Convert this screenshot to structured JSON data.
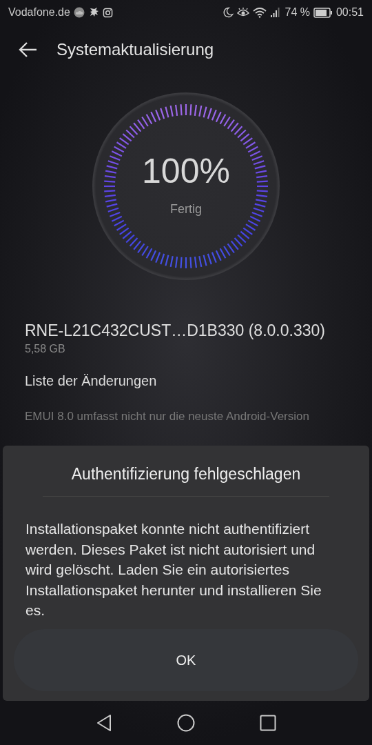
{
  "status_bar": {
    "carrier": "Vodafone.de",
    "battery_percent": "74 %",
    "time": "00:51"
  },
  "header": {
    "title": "Systemaktualisierung"
  },
  "progress": {
    "percent": "100%",
    "status": "Fertig"
  },
  "package": {
    "version": "RNE-L21C432CUST…D1B330 (8.0.0.330)",
    "size": "5,58 GB"
  },
  "changelog": {
    "heading": "Liste der Änderungen",
    "text": "EMUI 8.0 umfasst nicht nur die neuste Android-Version"
  },
  "dialog": {
    "title": "Authentifizierung fehlgeschlagen",
    "message": "Installationspaket konnte nicht authentifiziert werden. Dieses Paket ist nicht autorisiert und wird gelöscht. Laden Sie ein autorisiertes Installationspaket herunter und installieren Sie es.",
    "button": "OK"
  }
}
